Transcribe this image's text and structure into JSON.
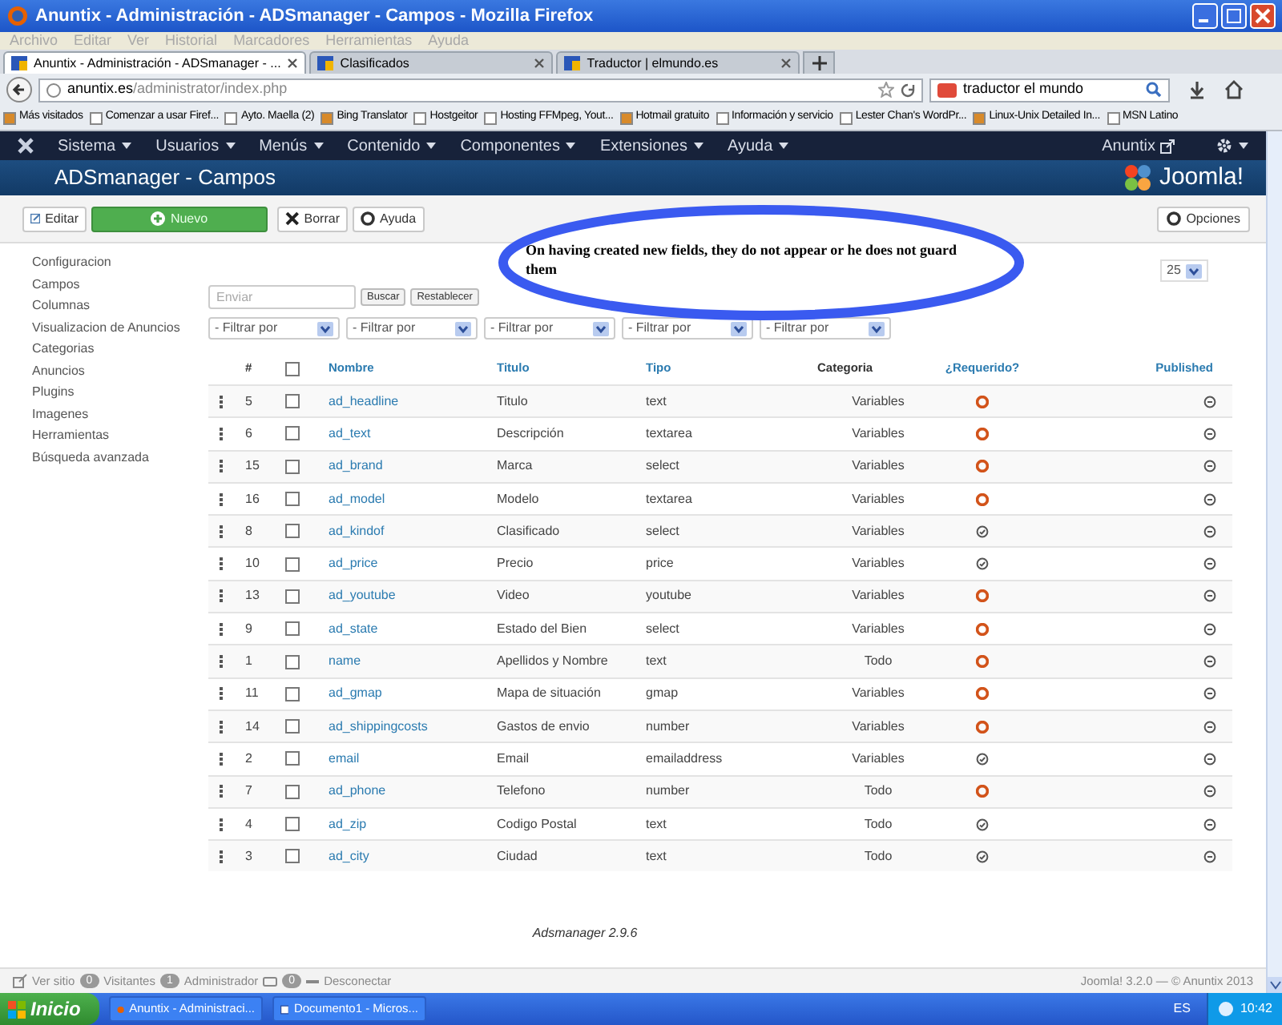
{
  "window": {
    "title": "Anuntix - Administración - ADSmanager - Campos - Mozilla Firefox"
  },
  "menu_bar": [
    "Archivo",
    "Editar",
    "Ver",
    "Historial",
    "Marcadores",
    "Herramientas",
    "Ayuda"
  ],
  "tabs": [
    {
      "label": "Anuntix - Administración - ADSmanager - ...",
      "selected": true
    },
    {
      "label": "Clasificados",
      "selected": false
    },
    {
      "label": "Traductor | elmundo.es",
      "selected": false
    }
  ],
  "address_bar": {
    "host": "anuntix.es",
    "path": "/administrator/index.php"
  },
  "search_field": {
    "value": "traductor el mundo"
  },
  "bookmarks": [
    "Más visitados",
    "Comenzar a usar Firef...",
    "Ayto. Maella (2)",
    "Bing Translator",
    "Hostgeitor",
    "Hosting FFMpeg, Yout...",
    "Hotmail gratuito",
    "Información y servicio",
    "Lester Chan's WordPr...",
    "Linux-Unix Detailed In...",
    "MSN Latino"
  ],
  "admin_menu": {
    "items": [
      "Sistema",
      "Usuarios",
      "Menús",
      "Contenido",
      "Componentes",
      "Extensiones",
      "Ayuda"
    ],
    "user": "Anuntix"
  },
  "page_title": "ADSmanager - Campos",
  "logo_text": "Joomla!",
  "toolbar": [
    {
      "label": "Editar",
      "kind": "edit"
    },
    {
      "label": "Nuevo",
      "kind": "new"
    },
    {
      "label": "Borrar",
      "kind": "delete"
    },
    {
      "label": "Ayuda",
      "kind": "help"
    }
  ],
  "options_button": "Opciones",
  "sidebar": [
    "Configuracion",
    "Campos",
    "Columnas",
    "Visualizacion de Anuncios",
    "Categorias",
    "Anuncios",
    "Plugins",
    "Imagenes",
    "Herramientas",
    "Búsqueda avanzada"
  ],
  "search": {
    "placeholder": "Enviar",
    "buttons": [
      "Buscar",
      "Restablecer"
    ]
  },
  "filters": [
    "- Filtrar por",
    "- Filtrar por",
    "- Filtrar por",
    "- Filtrar por",
    "- Filtrar por"
  ],
  "limit": "25",
  "annotation": "On having created new fields, they do not appear or he does not guard them",
  "table": {
    "all_checked": false,
    "columns": [
      {
        "label": "#",
        "link": false
      },
      {
        "label": "Nombre",
        "link": true
      },
      {
        "label": "Titulo",
        "link": true
      },
      {
        "label": "Tipo",
        "link": true
      },
      {
        "label": "Categoria",
        "link": false
      },
      {
        "label": "¿Requerido?",
        "link": true
      },
      {
        "label": "Published",
        "link": true
      }
    ],
    "rows": [
      {
        "id": "5",
        "name": "ad_headline",
        "title": "Titulo",
        "type": "text",
        "category": "Variables",
        "required": true,
        "published": false,
        "checked": false
      },
      {
        "id": "6",
        "name": "ad_text",
        "title": "Descripción",
        "type": "textarea",
        "category": "Variables",
        "required": true,
        "published": false,
        "checked": false
      },
      {
        "id": "15",
        "name": "ad_brand",
        "title": "Marca",
        "type": "select",
        "category": "Variables",
        "required": true,
        "published": false,
        "checked": false
      },
      {
        "id": "16",
        "name": "ad_model",
        "title": "Modelo",
        "type": "textarea",
        "category": "Variables",
        "required": true,
        "published": false,
        "checked": false
      },
      {
        "id": "8",
        "name": "ad_kindof",
        "title": "Clasificado",
        "type": "select",
        "category": "Variables",
        "required": false,
        "published": false,
        "checked": false
      },
      {
        "id": "10",
        "name": "ad_price",
        "title": "Precio",
        "type": "price",
        "category": "Variables",
        "required": false,
        "published": false,
        "checked": false
      },
      {
        "id": "13",
        "name": "ad_youtube",
        "title": "Video",
        "type": "youtube",
        "category": "Variables",
        "required": true,
        "published": false,
        "checked": false
      },
      {
        "id": "9",
        "name": "ad_state",
        "title": "Estado del Bien",
        "type": "select",
        "category": "Variables",
        "required": true,
        "published": false,
        "checked": false
      },
      {
        "id": "1",
        "name": "name",
        "title": "Apellidos y Nombre",
        "type": "text",
        "category": "Todo",
        "required": true,
        "published": false,
        "checked": false
      },
      {
        "id": "11",
        "name": "ad_gmap",
        "title": "Mapa de situación",
        "type": "gmap",
        "category": "Variables",
        "required": true,
        "published": false,
        "checked": false
      },
      {
        "id": "14",
        "name": "ad_shippingcosts",
        "title": "Gastos de envio",
        "type": "number",
        "category": "Variables",
        "required": true,
        "published": false,
        "checked": false
      },
      {
        "id": "2",
        "name": "email",
        "title": "Email",
        "type": "emailaddress",
        "category": "Variables",
        "required": false,
        "published": false,
        "checked": false
      },
      {
        "id": "7",
        "name": "ad_phone",
        "title": "Telefono",
        "type": "number",
        "category": "Todo",
        "required": true,
        "published": false,
        "checked": false
      },
      {
        "id": "4",
        "name": "ad_zip",
        "title": "Codigo Postal",
        "type": "text",
        "category": "Todo",
        "required": false,
        "published": false,
        "checked": false
      },
      {
        "id": "3",
        "name": "ad_city",
        "title": "Ciudad",
        "type": "text",
        "category": "Todo",
        "required": false,
        "published": false,
        "checked": false
      }
    ]
  },
  "version": "Adsmanager 2.9.6",
  "status_bar": {
    "view_site": "Ver sitio",
    "visitors": {
      "count": "0",
      "label": "Visitantes"
    },
    "admins": {
      "count": "1",
      "label": "Administrador"
    },
    "messages": {
      "count": "0"
    },
    "logout": "Desconectar",
    "copyright": "Joomla! 3.2.0 — © Anuntix 2013"
  },
  "taskbar": {
    "start": "Inicio",
    "tasks": [
      "Anuntix - Administraci...",
      "Documento1 - Micros..."
    ],
    "language": "ES",
    "clock": "10:42"
  }
}
